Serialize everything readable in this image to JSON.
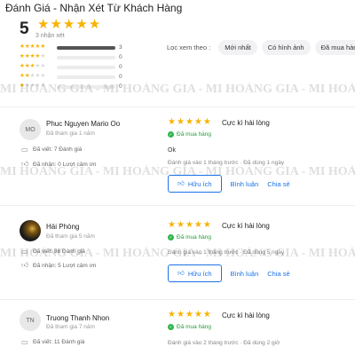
{
  "header": {
    "title": "Đánh Giá - Nhận Xét Từ Khách Hàng"
  },
  "summary": {
    "score": "5",
    "rating": 5,
    "count_text": "3 nhận xét",
    "distribution": [
      {
        "stars": 5,
        "count": "3",
        "fill": 1.0
      },
      {
        "stars": 4,
        "count": "0",
        "fill": 0
      },
      {
        "stars": 3,
        "count": "0",
        "fill": 0
      },
      {
        "stars": 2,
        "count": "0",
        "fill": 0
      },
      {
        "stars": 1,
        "count": "0",
        "fill": 0
      }
    ]
  },
  "filter": {
    "label": "Lọc xem theo :",
    "chips": [
      "Mới nhất",
      "Có hình ảnh",
      "Đã mua hàng"
    ]
  },
  "watermark": {
    "text": "MI HOÀNG GIA - MI HOÀNG GIA - MI HOÀNG GIA - MI HOÀNG GIA"
  },
  "reviews": [
    {
      "avatar_initials": "MO",
      "name": "Phuc Nguyen Mario Oo",
      "joined": "Đã tham gia 1 năm",
      "written": "Đã viết: 7 Đánh giá",
      "thanks": "Đã nhận: 0 Lượt cảm ơn",
      "rating": 5,
      "title": "Cực kì hài lòng",
      "verified": "Đã mua hàng",
      "content": "Ok",
      "info": "Đánh giá vào 1 tháng trước   ·   Đã dùng 1 ngày",
      "helpful": "Hữu ích",
      "reply": "Bình luận",
      "share": "Chia sẻ"
    },
    {
      "avatar_initials": "",
      "name": "Hải Phòng",
      "joined": "Đã tham gia 5 năm",
      "written": "Đã viết: 86 Đánh giá",
      "thanks": "Đã nhận: 5 Lượt cảm ơn",
      "rating": 5,
      "title": "Cực kì hài lòng",
      "verified": "Đã mua hàng",
      "content": "",
      "info": "Đánh giá vào 1 tháng trước   ·   Đã dùng 5 ngày",
      "helpful": "Hữu ích",
      "reply": "Bình luận",
      "share": "Chia sẻ"
    },
    {
      "avatar_initials": "TN",
      "name": "Truong Thanh Nhon",
      "joined": "Đã tham gia 7 năm",
      "written": "Đã viết: 11 Đánh giá",
      "thanks": "",
      "rating": 5,
      "title": "Cực kì hài lòng",
      "verified": "Đã mua hàng",
      "content": "",
      "info": "Đánh giá vào 2 tháng trước   ·   Đã dùng 2 giờ",
      "helpful": "",
      "reply": "",
      "share": ""
    }
  ],
  "colors": {
    "star": "#f6b300",
    "accent": "#1a73e8",
    "verified": "#2a9c3a"
  }
}
